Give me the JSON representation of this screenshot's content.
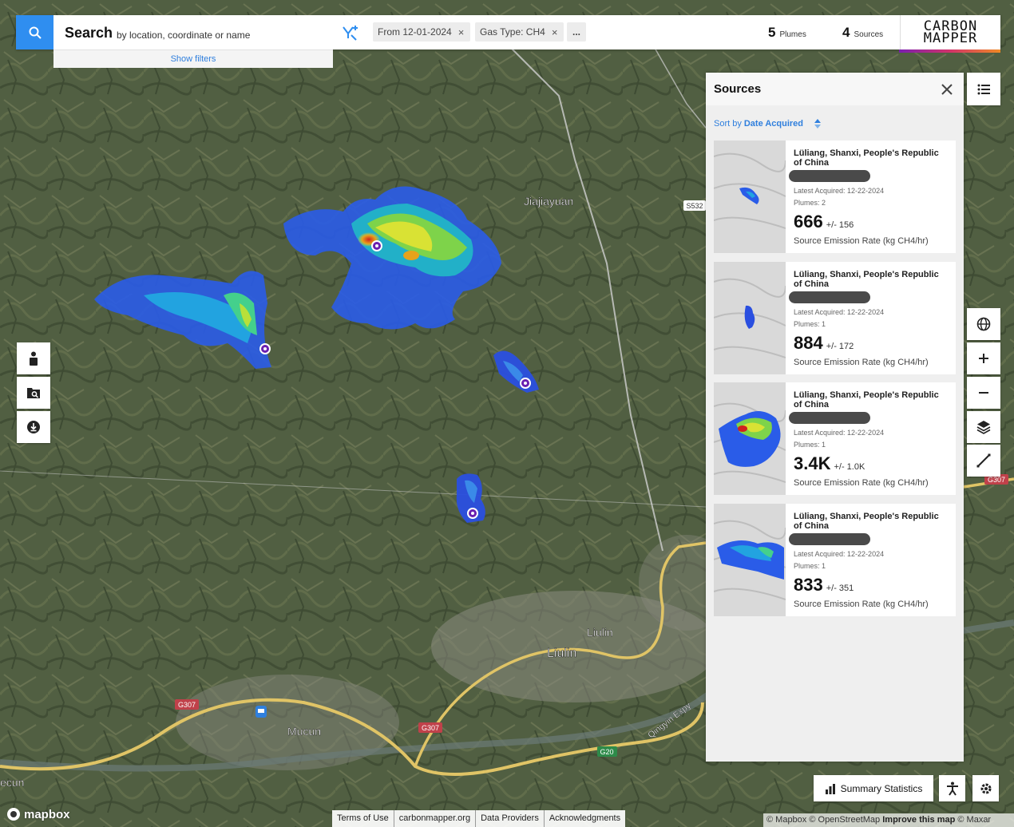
{
  "search": {
    "title": "Search",
    "subtitle": "by location, coordinate or name",
    "show_filters": "Show filters"
  },
  "filters": {
    "date_chip": "From 12-01-2024",
    "gas_chip": "Gas Type: CH4",
    "more": "...",
    "remove": "×"
  },
  "stats": {
    "plumes_count": "5",
    "plumes_label": "Plumes",
    "sources_count": "4",
    "sources_label": "Sources"
  },
  "logo": {
    "line1": "CARBON",
    "line2": "MAPPER"
  },
  "map_labels": {
    "jiajiayuan": "Jiajiayuan",
    "liulin_small": "Liulin",
    "liulin": "Liulin",
    "mucun": "Mucun",
    "ecun": "ecun",
    "s532": "S532",
    "g307_a": "G307",
    "g307_b": "G307",
    "g307_c": "G307",
    "g20": "G20",
    "qingyin": "Qingyin Expy"
  },
  "panel": {
    "title": "Sources",
    "sort_prefix": "Sort by",
    "sort_field": "Date Acquired",
    "cards": [
      {
        "location": "Lüliang, Shanxi, People's Republic of China",
        "latest": "Latest Acquired: 12-22-2024",
        "plumes": "Plumes: 2",
        "rate": "666",
        "uncertainty": "+/- 156",
        "unit": "Source Emission Rate (kg CH4/hr)"
      },
      {
        "location": "Lüliang, Shanxi, People's Republic of China",
        "latest": "Latest Acquired: 12-22-2024",
        "plumes": "Plumes: 1",
        "rate": "884",
        "uncertainty": "+/- 172",
        "unit": "Source Emission Rate (kg CH4/hr)"
      },
      {
        "location": "Lüliang, Shanxi, People's Republic of China",
        "latest": "Latest Acquired: 12-22-2024",
        "plumes": "Plumes: 1",
        "rate": "3.4K",
        "uncertainty": "+/- 1.0K",
        "unit": "Source Emission Rate (kg CH4/hr)"
      },
      {
        "location": "Lüliang, Shanxi, People's Republic of China",
        "latest": "Latest Acquired: 12-22-2024",
        "plumes": "Plumes: 1",
        "rate": "833",
        "uncertainty": "+/- 351",
        "unit": "Source Emission Rate (kg CH4/hr)"
      }
    ]
  },
  "bottom": {
    "summary": "Summary Statistics",
    "mapbox": "mapbox",
    "links": [
      "Terms of Use",
      "carbonmapper.org",
      "Data Providers",
      "Acknowledgments"
    ],
    "attribution_1": "© Mapbox © OpenStreetMap",
    "attribution_2": "Improve this map",
    "attribution_3": "© Maxar"
  },
  "colors": {
    "accent": "#2f8ef0",
    "link": "#2f7fdd",
    "marker": "#6a1fb0"
  }
}
